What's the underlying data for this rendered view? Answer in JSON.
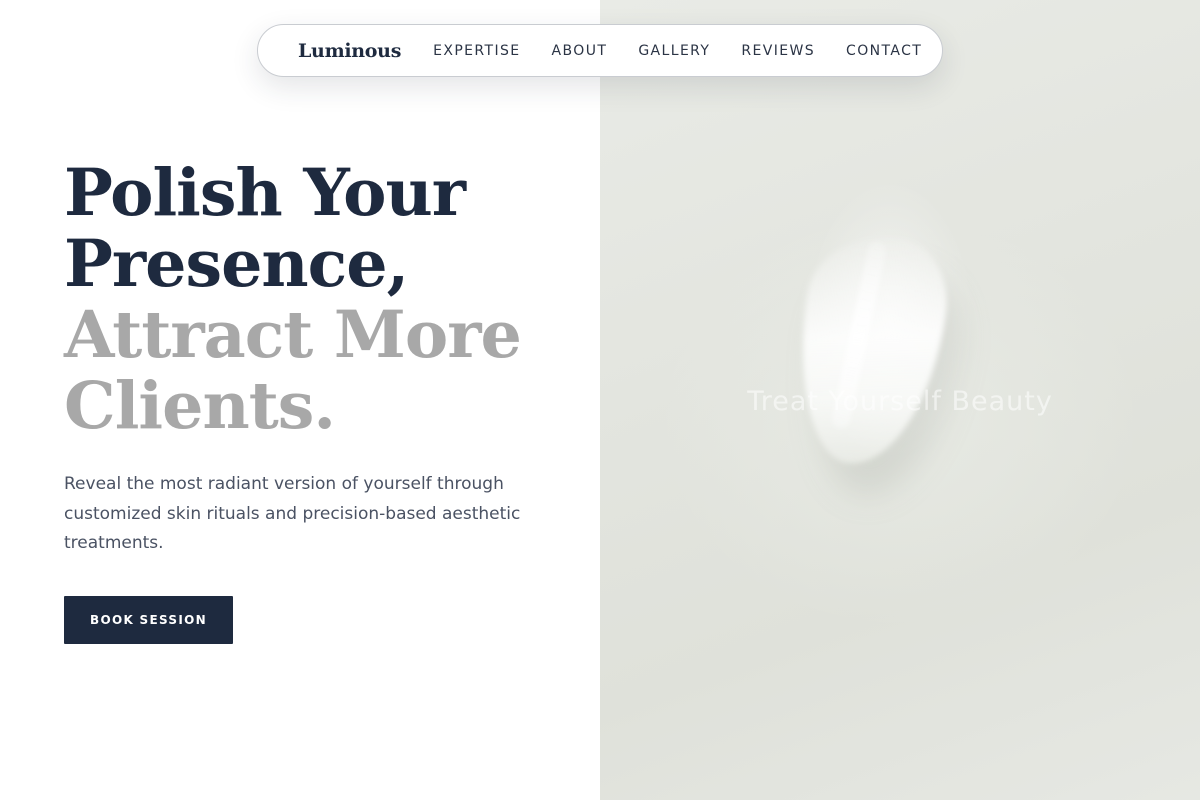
{
  "brand": {
    "name": "Luminous"
  },
  "nav": {
    "links": [
      {
        "label": "EXPERTISE"
      },
      {
        "label": "ABOUT"
      },
      {
        "label": "GALLERY"
      },
      {
        "label": "REVIEWS"
      },
      {
        "label": "CONTACT"
      }
    ]
  },
  "hero": {
    "title_lines": [
      {
        "text": "Polish Your",
        "tone": "dark"
      },
      {
        "text": "Presence,",
        "tone": "dark"
      },
      {
        "text": "Attract More",
        "tone": "muted"
      },
      {
        "text": "Clients.",
        "tone": "muted"
      }
    ],
    "subtitle": "Reveal the most radiant version of yourself through customized skin rituals and precision-based aesthetic treatments.",
    "cta_label": "BOOK SESSION"
  },
  "image": {
    "caption": "Treat Yourself Beauty"
  },
  "colors": {
    "primary": "#1e2a3f",
    "muted_heading": "#a8a8a8",
    "body_text": "#4a5263",
    "image_background": "#e3e5df"
  }
}
